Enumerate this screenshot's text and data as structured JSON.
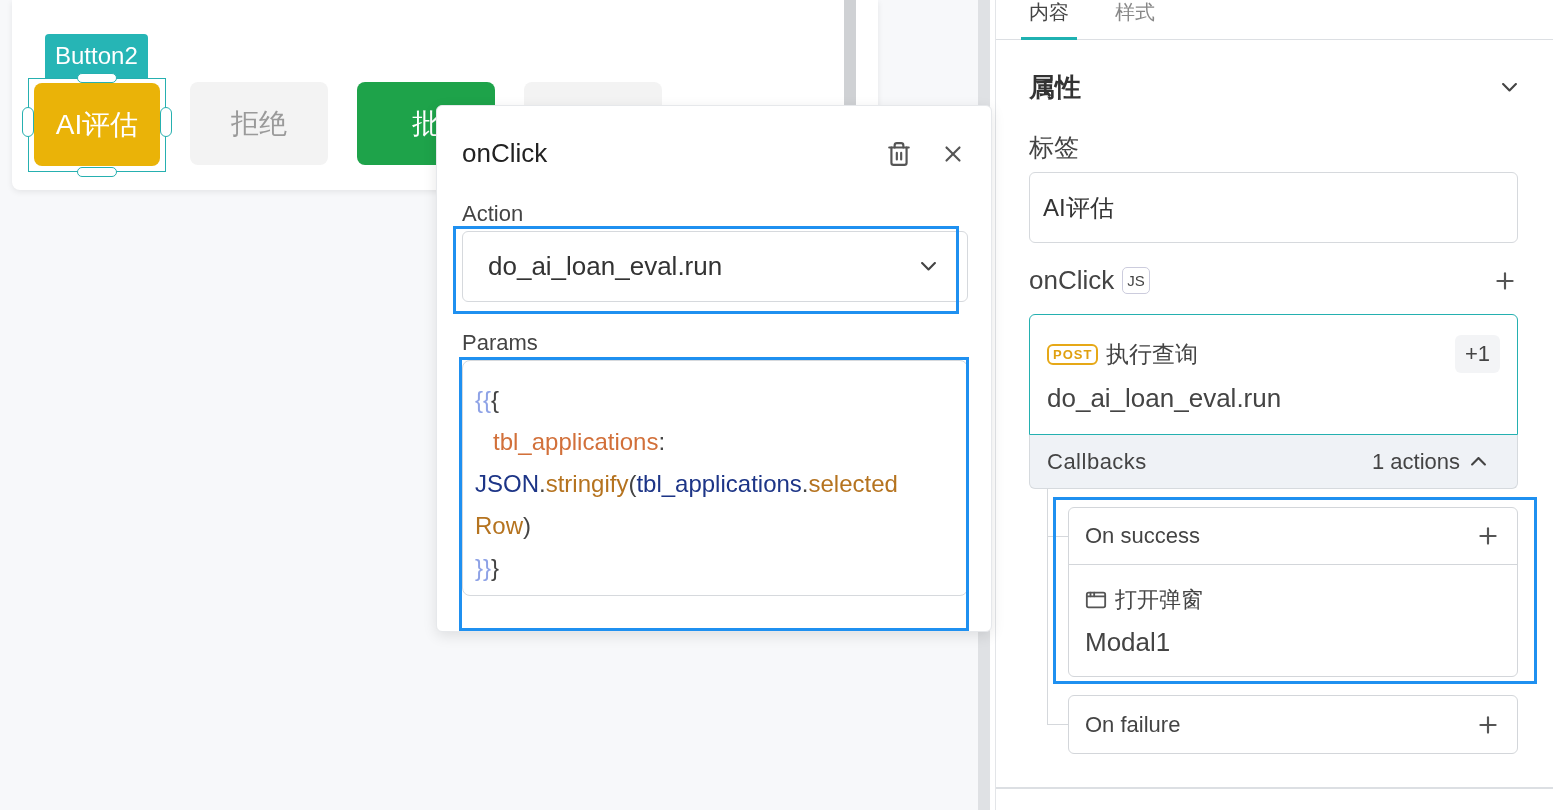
{
  "canvas": {
    "buttons": [
      {
        "label": "AI评估",
        "kind": "warning",
        "selected": true,
        "tag": "Button2"
      },
      {
        "label": "拒绝",
        "kind": "default",
        "selected": false
      },
      {
        "label": "批",
        "kind": "success",
        "selected": false
      },
      {
        "kind": "default",
        "selected": false
      }
    ]
  },
  "popover": {
    "title": "onClick",
    "action_label": "Action",
    "action_value": "do_ai_loan_eval.run",
    "params_label": "Params",
    "params_lines": [
      {
        "indent": false,
        "tokens": [
          {
            "text": "{{",
            "kind": "brace"
          },
          {
            "text": "{",
            "kind": "punct"
          }
        ]
      },
      {
        "indent": true,
        "tokens": [
          {
            "text": "tbl_applications",
            "kind": "key"
          },
          {
            "text": ":",
            "kind": "punct"
          }
        ]
      },
      {
        "indent": false,
        "tokens": [
          {
            "text": "JSON",
            "kind": "ident"
          },
          {
            "text": ".",
            "kind": "punct"
          },
          {
            "text": "stringify",
            "kind": "member"
          },
          {
            "text": "(",
            "kind": "punct"
          },
          {
            "text": "tbl_applications",
            "kind": "ident"
          },
          {
            "text": ".",
            "kind": "punct"
          },
          {
            "text": "selected",
            "kind": "member"
          }
        ]
      },
      {
        "indent": false,
        "tokens": [
          {
            "text": "Row",
            "kind": "member"
          },
          {
            "text": ")",
            "kind": "punct"
          }
        ]
      },
      {
        "indent": false,
        "tokens": [
          {
            "text": "}}",
            "kind": "brace"
          },
          {
            "text": "}",
            "kind": "punct"
          }
        ]
      }
    ]
  },
  "panel": {
    "tabs": [
      {
        "label": "内容",
        "selected": true
      },
      {
        "label": "样式",
        "selected": false
      }
    ],
    "section": {
      "title": "属性",
      "expanded": true
    },
    "label_field": {
      "label": "标签",
      "value": "AI评估"
    },
    "event": {
      "name": "onClick",
      "badge": "JS"
    },
    "action_card": {
      "method": "POST",
      "title": "执行查询",
      "extra": "+1",
      "query": "do_ai_loan_eval.run",
      "callbacks": {
        "label": "Callbacks",
        "count": "1 actions",
        "expanded": true
      }
    },
    "callbacks": [
      {
        "title": "On success",
        "actions": [
          {
            "title": "打开弹窗",
            "target": "Modal1"
          }
        ]
      },
      {
        "title": "On failure"
      }
    ]
  }
}
